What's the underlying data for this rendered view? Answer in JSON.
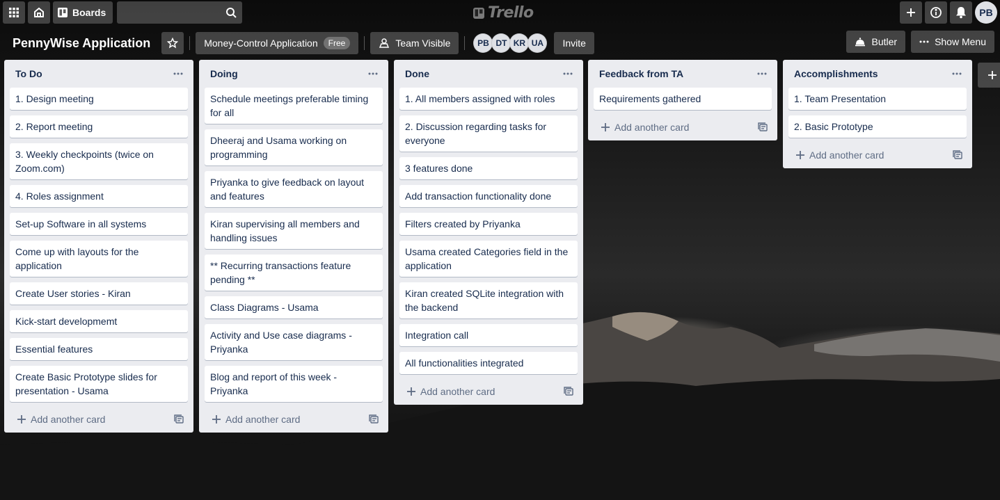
{
  "nav": {
    "boards_label": "Boards",
    "search_value": "",
    "logo_text": "Trello",
    "user_initials": "PB"
  },
  "board": {
    "title": "PennyWise Application",
    "team_label": "Money-Control Application",
    "team_badge": "Free",
    "visibility_label": "Team Visible",
    "members": [
      "PB",
      "DT",
      "KR",
      "UA"
    ],
    "invite_label": "Invite",
    "butler_label": "Butler",
    "show_menu_label": "Show Menu"
  },
  "lists": [
    {
      "title": "To Do",
      "cards": [
        "1. Design meeting",
        "2. Report meeting",
        "3. Weekly checkpoints (twice on Zoom.com)",
        "4. Roles assignment",
        "Set-up Software in all systems",
        "Come up with layouts for the application",
        "Create User stories - Kiran",
        "Kick-start developmemt",
        "Essential features",
        "Create Basic Prototype slides for presentation - Usama"
      ],
      "add_label": "Add another card"
    },
    {
      "title": "Doing",
      "cards": [
        "Schedule meetings preferable timing for all",
        "Dheeraj and Usama working on programming",
        "Priyanka to give feedback on layout and features",
        "Kiran supervising all members and handling issues",
        "** Recurring transactions feature pending **",
        "Class Diagrams - Usama",
        "Activity and Use case diagrams - Priyanka",
        "Blog and report of this week - Priyanka"
      ],
      "add_label": "Add another card"
    },
    {
      "title": "Done",
      "cards": [
        "1. All members assigned with roles",
        "2. Discussion regarding tasks for everyone",
        "3 features done",
        "Add transaction functionality done",
        "Filters created by Priyanka",
        "Usama created Categories field in the application",
        "Kiran created SQLite integration with the backend",
        "Integration call",
        "All functionalities integrated"
      ],
      "add_label": "Add another card"
    },
    {
      "title": "Feedback from TA",
      "cards": [
        "Requirements gathered"
      ],
      "add_label": "Add another card"
    },
    {
      "title": "Accomplishments",
      "cards": [
        "1. Team Presentation",
        "2. Basic Prototype"
      ],
      "add_label": "Add another card"
    }
  ],
  "icons": {
    "apps": "apps-grid-icon",
    "home": "home-icon",
    "boards": "boards-icon",
    "search": "search-icon",
    "create": "plus-icon",
    "info": "info-icon",
    "notifications": "bell-icon",
    "star": "star-icon",
    "visibility": "team-icon",
    "butler": "butler-icon",
    "menu": "more-icon",
    "list_menu": "more-icon",
    "template": "card-template-icon",
    "add_list": "plus-icon"
  }
}
